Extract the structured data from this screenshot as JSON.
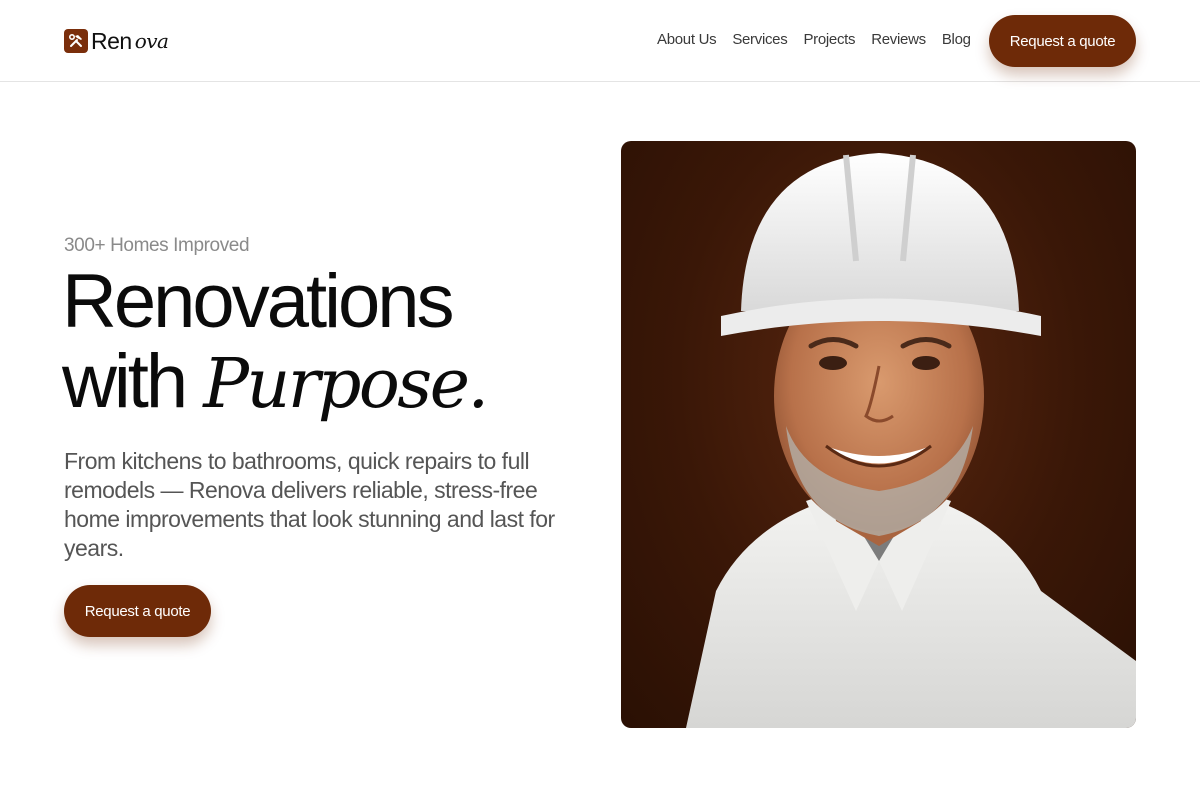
{
  "brand": {
    "name_prefix": "Ren",
    "name_suffix": "ova",
    "logo_icon": "hammer-wrench-icon",
    "accent_color": "#6e2a08"
  },
  "nav": {
    "items": [
      {
        "label": "About Us"
      },
      {
        "label": "Services"
      },
      {
        "label": "Projects"
      },
      {
        "label": "Reviews"
      },
      {
        "label": "Blog"
      }
    ],
    "cta_label": "Request a quote"
  },
  "hero": {
    "eyebrow": "300+ Homes Improved",
    "headline_line1": "Renovations",
    "headline_line2_plain": "with ",
    "headline_line2_serif": "Purpose.",
    "lede": "From kitchens to bathrooms, quick repairs to full remodels — Renova delivers reliable, stress-free home improvements that look stunning and last for years.",
    "cta_label": "Request a quote"
  }
}
